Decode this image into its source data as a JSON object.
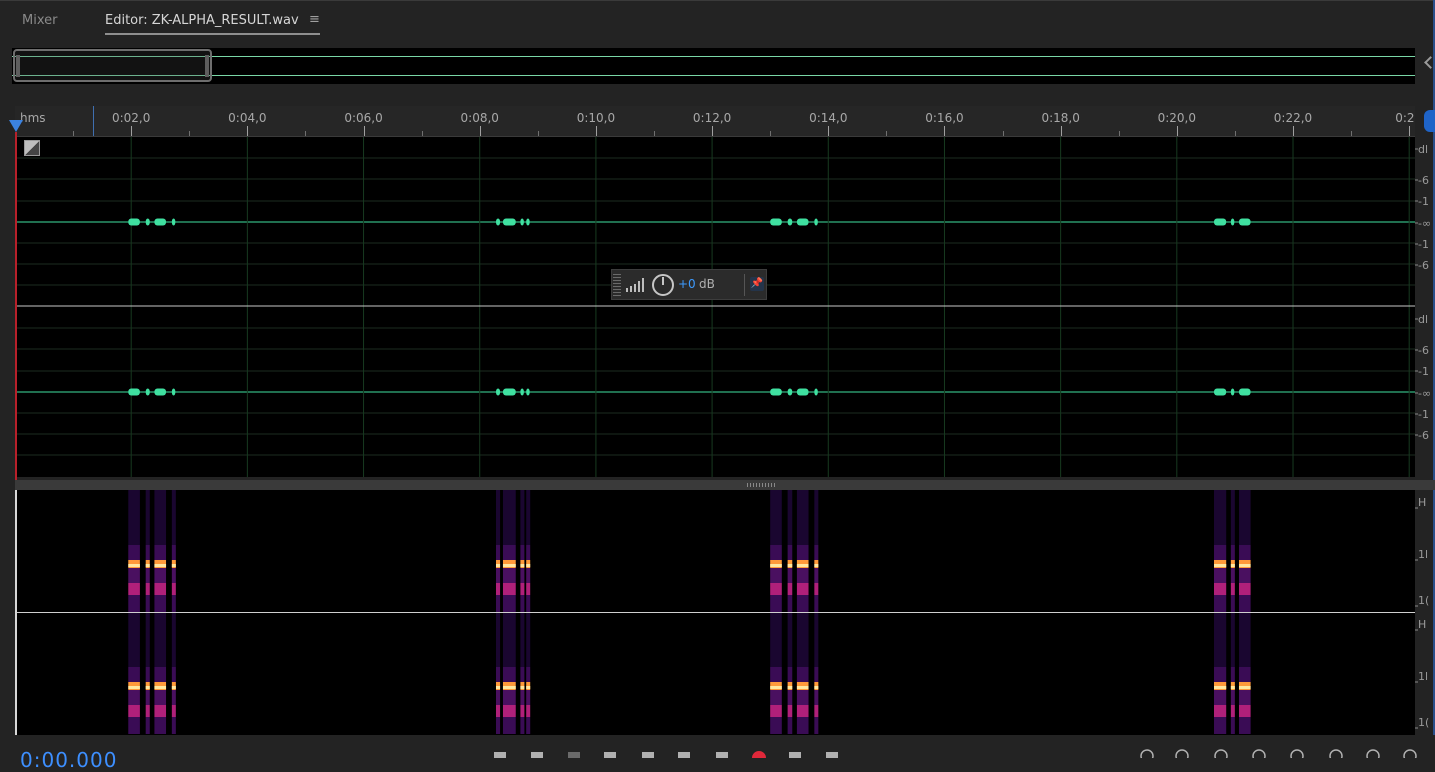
{
  "tabs": {
    "mixer": "Mixer",
    "editor": "Editor: ZK-ALPHA_RESULT.wav",
    "menu_icon": "≡"
  },
  "ruler": {
    "unit": "hms",
    "ticks": [
      {
        "t": 2,
        "label": "0:02,0"
      },
      {
        "t": 4,
        "label": "0:04,0"
      },
      {
        "t": 6,
        "label": "0:06,0"
      },
      {
        "t": 8,
        "label": "0:08,0"
      },
      {
        "t": 10,
        "label": "0:10,0"
      },
      {
        "t": 12,
        "label": "0:12,0"
      },
      {
        "t": 14,
        "label": "0:14,0"
      },
      {
        "t": 16,
        "label": "0:16,0"
      },
      {
        "t": 18,
        "label": "0:18,0"
      },
      {
        "t": 20,
        "label": "0:20,0"
      },
      {
        "t": 22,
        "label": "0:22,0"
      },
      {
        "t": 24,
        "label": "0:2"
      }
    ],
    "view_start_s": 0,
    "view_end_s": 24.1
  },
  "hud": {
    "value": "+0",
    "unit": "dB",
    "pin_icon": "pin-icon"
  },
  "db_scale": {
    "labels": [
      "dl",
      "-6",
      "-1",
      "-∞",
      "-1",
      "-6"
    ]
  },
  "hz_scale": {
    "labels": [
      "H",
      "1l",
      "1("
    ]
  },
  "bursts": [
    {
      "segments": [
        [
          1.95,
          2.15
        ],
        [
          2.25,
          2.32
        ],
        [
          2.4,
          2.6
        ],
        [
          2.7,
          2.76
        ]
      ]
    },
    {
      "segments": [
        [
          8.28,
          8.35
        ],
        [
          8.4,
          8.62
        ],
        [
          8.7,
          8.76
        ],
        [
          8.8,
          8.86
        ]
      ]
    },
    {
      "segments": [
        [
          13.0,
          13.2
        ],
        [
          13.3,
          13.38
        ],
        [
          13.46,
          13.66
        ],
        [
          13.76,
          13.82
        ]
      ]
    },
    {
      "segments": [
        [
          20.64,
          20.85
        ],
        [
          20.93,
          20.99
        ],
        [
          21.07,
          21.27
        ]
      ]
    }
  ],
  "transport": {
    "time": "0:00.000",
    "icons": [
      "stop-icon",
      "play-icon",
      "pause-icon",
      "move-to-start-icon",
      "rewind-icon",
      "fast-forward-icon",
      "move-to-end-icon",
      "record-icon",
      "loop-icon",
      "skip-selection-icon"
    ]
  },
  "zoom": {
    "icons": [
      "zoom-in-amplitude-icon",
      "zoom-out-amplitude-icon",
      "zoom-in-time-icon",
      "zoom-out-time-icon",
      "zoom-out-full-icon",
      "zoom-in-left-icon",
      "zoom-in-right-icon",
      "zoom-selection-icon"
    ]
  },
  "colors": {
    "waveform": "#3fe0a0",
    "playhead": "#b8202a",
    "accent": "#3d8fff",
    "spectral_hot": "#ffb060"
  }
}
